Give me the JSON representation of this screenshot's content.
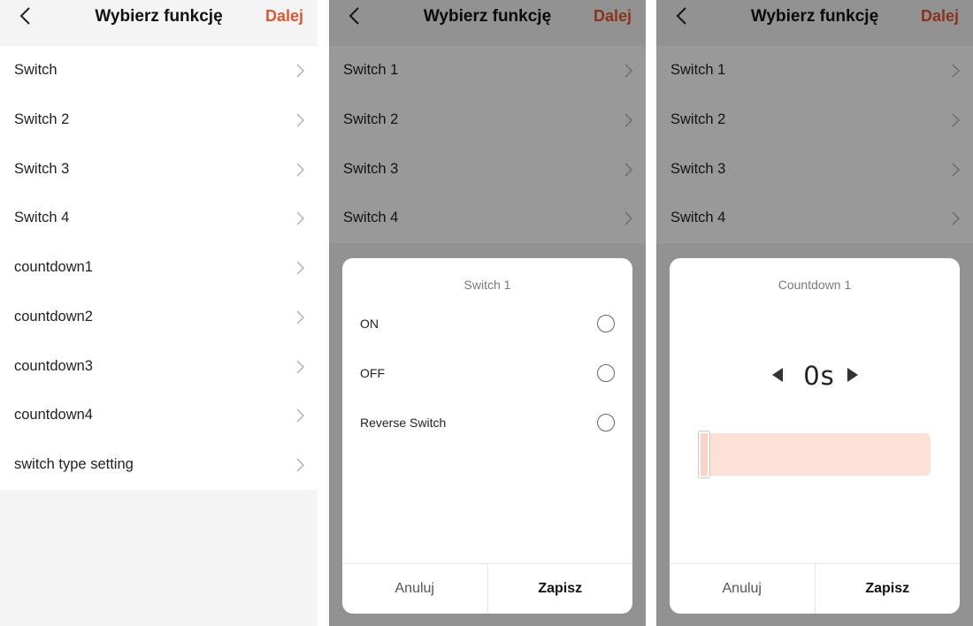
{
  "colors": {
    "accent": "#e4572e",
    "slider_fill": "#fde0d6",
    "overlay": "rgba(0,0,0,0.40)"
  },
  "icons": {
    "back": "chevron-left-icon",
    "row": "chevron-right-icon",
    "decrement": "triangle-left-icon",
    "increment": "triangle-right-icon"
  },
  "screen1": {
    "header": {
      "title": "Wybierz funkcję",
      "next_label": "Dalej"
    },
    "items": [
      {
        "label": "Switch"
      },
      {
        "label": "Switch 2"
      },
      {
        "label": "Switch 3"
      },
      {
        "label": "Switch 4"
      },
      {
        "label": "countdown1"
      },
      {
        "label": "countdown2"
      },
      {
        "label": "countdown3"
      },
      {
        "label": "countdown4"
      },
      {
        "label": "switch type setting"
      }
    ]
  },
  "screen2": {
    "header": {
      "title": "Wybierz funkcję",
      "next_label": "Dalej"
    },
    "items": [
      {
        "label": "Switch 1"
      },
      {
        "label": "Switch 2"
      },
      {
        "label": "Switch 3"
      },
      {
        "label": "Switch 4"
      }
    ],
    "dialog": {
      "title": "Switch 1",
      "options": [
        {
          "label": "ON",
          "selected": false
        },
        {
          "label": "OFF",
          "selected": false
        },
        {
          "label": "Reverse Switch",
          "selected": false
        }
      ],
      "cancel_label": "Anuluj",
      "save_label": "Zapisz"
    }
  },
  "screen3": {
    "header": {
      "title": "Wybierz funkcję",
      "next_label": "Dalej"
    },
    "items": [
      {
        "label": "Switch 1"
      },
      {
        "label": "Switch 2"
      },
      {
        "label": "Switch 3"
      },
      {
        "label": "Switch 4"
      }
    ],
    "dialog": {
      "title": "Countdown 1",
      "value": "0s",
      "slider_fraction": 0,
      "cancel_label": "Anuluj",
      "save_label": "Zapisz"
    }
  }
}
